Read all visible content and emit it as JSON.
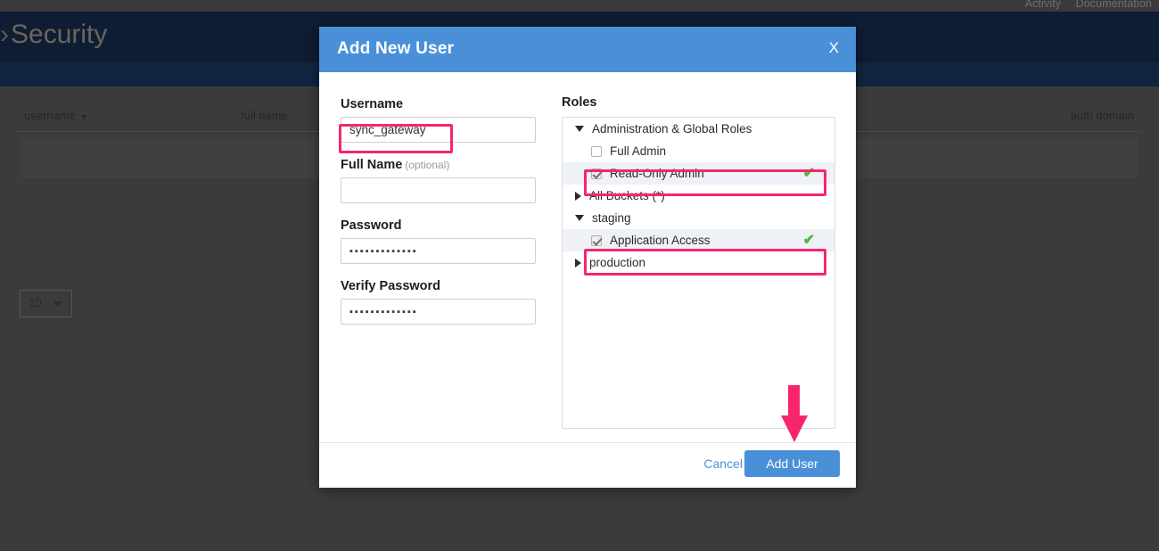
{
  "topbar": {
    "links": [
      "Activity",
      "Documentation"
    ]
  },
  "breadcrumb": {
    "chevron": "›",
    "title": "Security"
  },
  "users_table": {
    "columns": {
      "username": "username",
      "full_name": "full name",
      "auth_domain": "auth domain"
    },
    "sort_caret": "▼",
    "page_size": "10"
  },
  "dialog": {
    "title": "Add New User",
    "close_label": "X",
    "header_color": "#4a90d9",
    "fields": {
      "username": {
        "label": "Username",
        "value": "sync_gateway",
        "placeholder": ""
      },
      "full_name": {
        "label": "Full Name",
        "optional": "(optional)",
        "value": "",
        "placeholder": ""
      },
      "password": {
        "label": "Password",
        "value": "▪▪▪▪▪▪▪▪▪▪▪▪▪"
      },
      "verify_password": {
        "label": "Verify Password",
        "value": "▪▪▪▪▪▪▪▪▪▪▪▪▪"
      }
    },
    "roles": {
      "label": "Roles",
      "tree": [
        {
          "label": "Administration & Global Roles",
          "type": "group",
          "expanded": true
        },
        {
          "label": "Full Admin",
          "type": "leaf",
          "checked": false,
          "selected": false
        },
        {
          "label": "Read-Only Admin",
          "type": "leaf",
          "checked": true,
          "selected": true,
          "check_mark": "✔"
        },
        {
          "label": "All Buckets (*)",
          "type": "group",
          "expanded": false
        },
        {
          "label": "staging",
          "type": "group",
          "expanded": true
        },
        {
          "label": "Application Access",
          "type": "leaf",
          "checked": true,
          "selected": true,
          "check_mark": "✔"
        },
        {
          "label": "production",
          "type": "group",
          "expanded": false
        }
      ]
    },
    "footer": {
      "cancel_label": "Cancel",
      "submit_label": "Add User"
    }
  },
  "annotations": {
    "highlight_color": "#f7266c",
    "arrow_direction": "down"
  }
}
